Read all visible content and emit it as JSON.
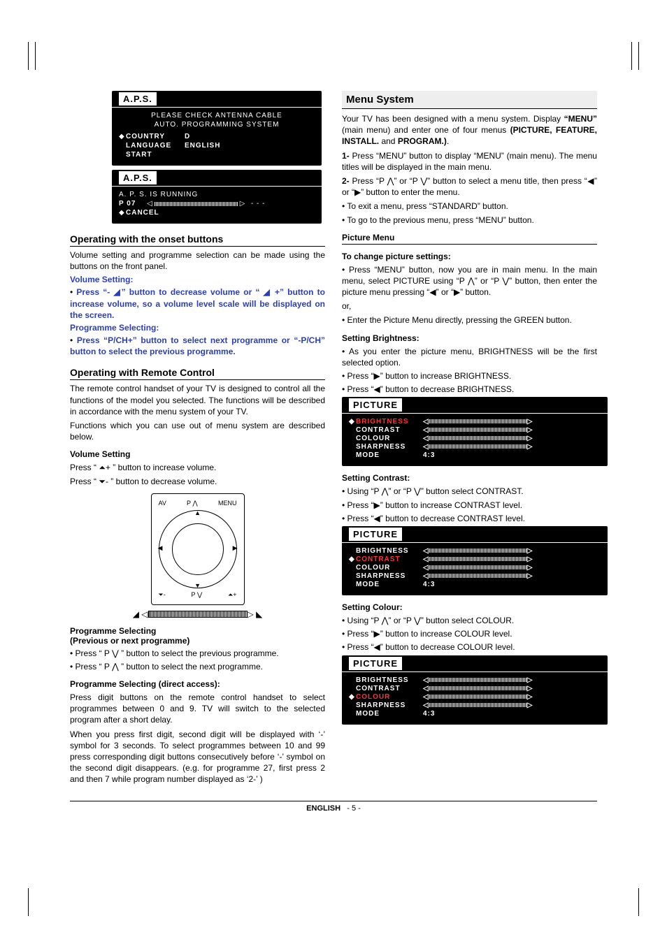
{
  "aps1": {
    "title": "A.P.S.",
    "line1": "PLEASE  CHECK  ANTENNA  CABLE",
    "line2": "AUTO.  PROGRAMMING  SYSTEM",
    "rows": [
      {
        "label": "COUNTRY",
        "value": "D"
      },
      {
        "label": "LANGUAGE",
        "value": "ENGLISH"
      },
      {
        "label": "START",
        "value": ""
      }
    ]
  },
  "aps2": {
    "title": "A.P.S.",
    "line1": "A. P. S.  IS  RUNNING",
    "line2": "P 07",
    "cancel": "CANCEL"
  },
  "left": {
    "h_onset": "Operating with the onset buttons",
    "onset_intro": "Volume setting and programme selection can be made using the buttons on the front panel.",
    "vol_set_h": "Volume Setting:",
    "vol_set_b": "Press “- ◢” button to decrease volume or “ ◢ +” button to increase volume, so a volume level scale will be displayed on the screen.",
    "prog_sel_h": "Programme Selecting:",
    "prog_sel_b": "Press “P/CH+” button to select next programme or “-P/CH” button to select the previous programme.",
    "h_remote": "Operating with Remote Control",
    "remote_p1": "The remote control handset of your TV is designed to control all the functions of the model you selected. The functions will be described  in accordance with the menu system of your TV.",
    "remote_p2": "Functions which you can use out of menu system are described below.",
    "vol2_h": "Volume Setting",
    "vol2_inc": "Press “ ⏶+ ” button to increase volume.",
    "vol2_dec": "Press “ ⏷- ”  button  to decrease volume.",
    "remote_labels": {
      "up": "P ⋀",
      "down": "P ⋁",
      "left": "⏷-",
      "right": "⏶+",
      "av": "AV",
      "menu": "MENU",
      "tl": "◀",
      "tr": "▶",
      "bl": "▼",
      "br": "▲"
    },
    "prog2_h1": "Programme Selecting",
    "prog2_h2": "(Previous or next programme)",
    "prog2_b1": "Press “ P ⋁ ” button to select the previous programme.",
    "prog2_b2": "Press “ P ⋀ ” button to select the next programme.",
    "prog3_h": "Programme Selecting (direct access):",
    "prog3_p1": "Press digit buttons on the remote control handset to select programmes between 0 and 9. TV will switch to the selected program after a short delay.",
    "prog3_p2": "When you press first digit, second digit will be displayed with ‘-’ symbol for 3 seconds. To select programmes between 10 and 99 press corresponding digit buttons consecutively before ‘-’ symbol on the second digit disappears. (e.g. for programme 27, first press 2 and then 7 while program number displayed as ‘2-’ )"
  },
  "right": {
    "h_menu": "Menu System",
    "menu_p1a": "Your TV has been designed with a menu system. Display ",
    "menu_p1b": "“MENU”",
    "menu_p1c": " (main menu) and enter one of four menus ",
    "menu_p1d": "(PICTURE, FEATURE, INSTALL.",
    "menu_p1e": " and ",
    "menu_p1f": "PROGRAM.)",
    "menu_li1": "Press “MENU” button to display “MENU” (main menu). The menu titles will be displayed in the main menu.",
    "menu_li2": "Press “P ⋀” or “P ⋁” button to select a menu title, then press “◀” or “▶” button to enter the menu.",
    "menu_li3": "To exit a menu, press “STANDARD” button.",
    "menu_li4": "To go to the previous menu, press “MENU” button.",
    "pic_h": "Picture Menu",
    "change_h": "To change picture settings:",
    "change_b1": "Press “MENU” button, now you are in main menu. In the main menu, select PICTURE using “P ⋀” or “P ⋁” button, then enter the picture menu pressing “◀” or “▶” button.",
    "or": "or,",
    "change_b2": "Enter the Picture Menu directly, pressing the GREEN button.",
    "bright_h": "Setting Brightness:",
    "bright_b1": "As you enter the picture menu, BRIGHTNESS will be the first selected option.",
    "bright_b2": "Press “▶” button to increase BRIGHTNESS.",
    "bright_b3": "Press “◀” button  to decrease BRIGHTNESS.",
    "contrast_h": "Setting Contrast:",
    "contrast_b1": "Using “P ⋀” or “P ⋁” button select CONTRAST.",
    "contrast_b2": "Press “▶” button to increase CONTRAST level.",
    "contrast_b3": "Press “◀” button to decrease CONTRAST level.",
    "colour_h": "Setting Colour:",
    "colour_b1": "Using “P ⋀” or “P ⋁” button select COLOUR.",
    "colour_b2": "Press “▶” button to increase COLOUR level.",
    "colour_b3": "Press “◀” button to decrease COLOUR level.",
    "osd_pic_title": "PICTURE",
    "osd_items": [
      "BRIGHTNESS",
      "CONTRAST",
      "COLOUR",
      "SHARPNESS",
      "MODE"
    ],
    "osd_mode_val": "4:3"
  },
  "footer": {
    "lang": "ENGLISH",
    "page": "- 5 -"
  }
}
